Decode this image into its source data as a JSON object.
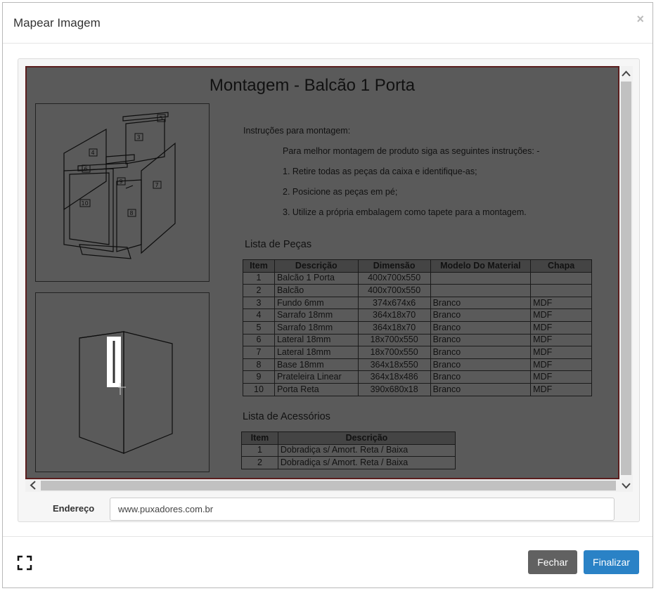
{
  "modal": {
    "title": "Mapear Imagem",
    "close_symbol": "×"
  },
  "document": {
    "title": "Montagem - Balcão 1 Porta",
    "instructions_heading": "Instruções para montagem:",
    "instructions_intro": "Para melhor montagem de produto siga as seguintes instruções: -",
    "steps": [
      "1. Retire todas as peças da caixa e identifique-as;",
      "2. Posicione as peças em pé;",
      "3. Utilize a própria embalagem  como tapete para a montagem."
    ],
    "parts_title": "Lista de Peças",
    "parts_headers": [
      "Item",
      "Descrição",
      "Dimensão",
      "Modelo Do Material",
      "Chapa"
    ],
    "parts_rows": [
      [
        "1",
        "Balcão 1 Porta",
        "400x700x550",
        "",
        ""
      ],
      [
        "2",
        "Balcão",
        "400x700x550",
        "",
        ""
      ],
      [
        "3",
        "Fundo 6mm",
        "374x674x6",
        "Branco",
        "MDF"
      ],
      [
        "4",
        "Sarrafo 18mm",
        "364x18x70",
        "Branco",
        "MDF"
      ],
      [
        "5",
        "Sarrafo 18mm",
        "364x18x70",
        "Branco",
        "MDF"
      ],
      [
        "6",
        "Lateral 18mm",
        "18x700x550",
        "Branco",
        "MDF"
      ],
      [
        "7",
        "Lateral 18mm",
        "18x700x550",
        "Branco",
        "MDF"
      ],
      [
        "8",
        "Base 18mm",
        "364x18x550",
        "Branco",
        "MDF"
      ],
      [
        "9",
        "Prateleira Linear",
        "364x18x486",
        "Branco",
        "MDF"
      ],
      [
        "10",
        "Porta Reta",
        "390x680x18",
        "Branco",
        "MDF"
      ]
    ],
    "accessories_title": "Lista de Acessórios",
    "accessories_headers": [
      "Item",
      "Descrição"
    ],
    "accessories_rows": [
      [
        "1",
        "Dobradiça s/ Amort. Reta / Baixa"
      ],
      [
        "2",
        "Dobradiça s/ Amort. Reta / Baixa"
      ]
    ],
    "figure_labels": [
      "5",
      "3",
      "4",
      "6",
      "9",
      "7",
      "10",
      "8"
    ]
  },
  "address": {
    "label": "Endereço",
    "value": "www.puxadores.com.br"
  },
  "footer": {
    "close_label": "Fechar",
    "finish_label": "Finalizar"
  },
  "icons": {
    "fullscreen": "fullscreen-icon",
    "scroll_up": "chevron-up-icon",
    "scroll_down": "chevron-down-icon",
    "scroll_left": "chevron-left-icon"
  },
  "colors": {
    "primary": "#2a82c6",
    "secondary": "#616161",
    "overlay": "#5a5a5a"
  }
}
